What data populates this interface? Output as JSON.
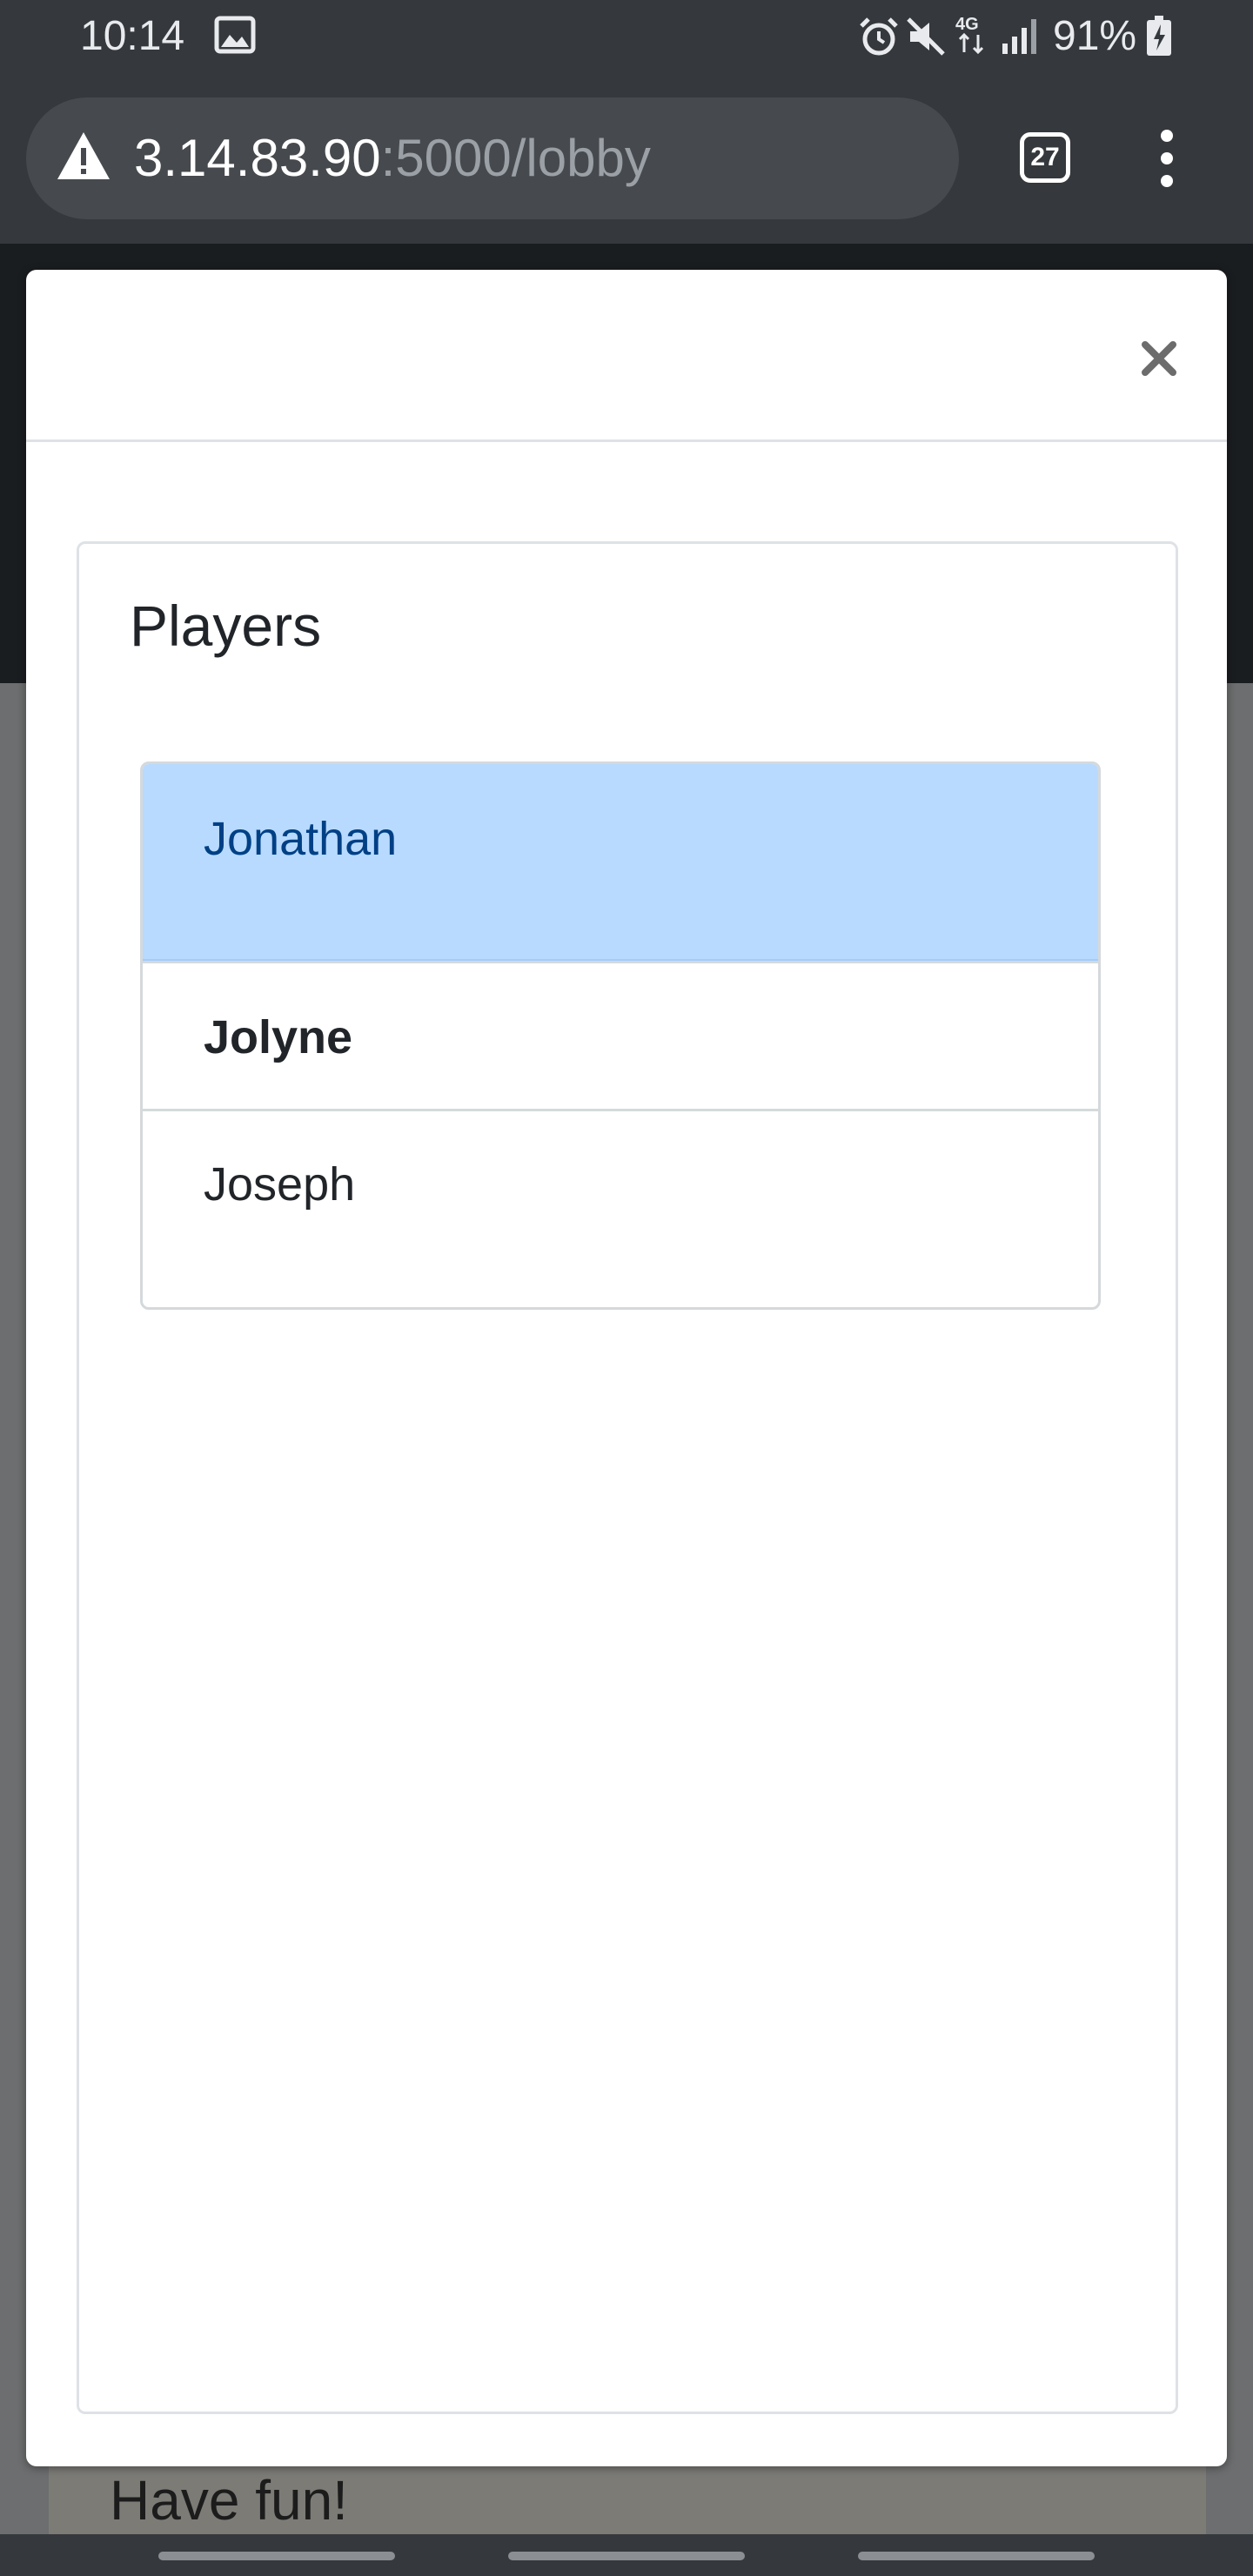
{
  "status_bar": {
    "time": "10:14",
    "battery_percent": "91%",
    "icons": [
      "gallery-icon",
      "alarm-icon",
      "mute-icon",
      "network-4g-icon",
      "signal-icon",
      "battery-charging-icon"
    ]
  },
  "browser": {
    "url_host": "3.14.83.90",
    "url_path": ":5000/lobby",
    "tab_count": "27",
    "icons": [
      "not-secure-warning-icon",
      "more-menu-icon"
    ]
  },
  "background_page": {
    "card_text": "Have fun!"
  },
  "modal": {
    "close_label": "×",
    "card_title": "Players",
    "players": [
      {
        "name": "Jonathan",
        "state": "active"
      },
      {
        "name": "Jolyne",
        "state": "bold"
      },
      {
        "name": "Joseph",
        "state": "plain"
      }
    ]
  },
  "colors": {
    "active_bg": "#b8daff",
    "active_text": "#004085",
    "chrome_bg": "#35383c"
  }
}
